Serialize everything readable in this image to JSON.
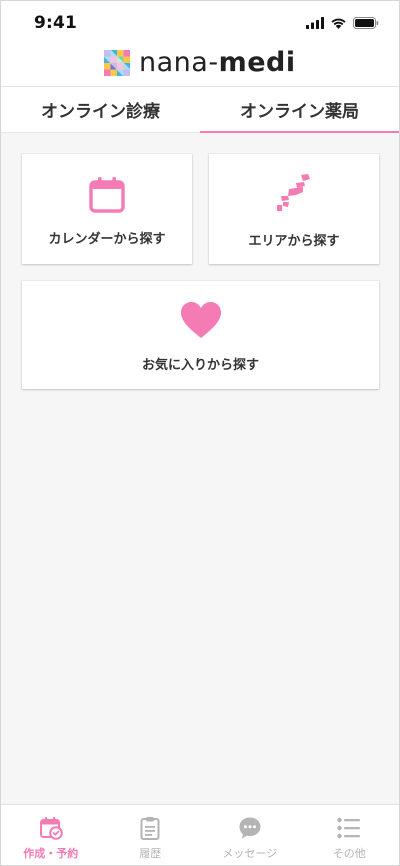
{
  "status": {
    "time": "9:41"
  },
  "header": {
    "logo_prefix": "nana-",
    "logo_suffix": "medi"
  },
  "tabs": [
    {
      "label": "オンライン診療",
      "active": false
    },
    {
      "label": "オンライン薬局",
      "active": true
    }
  ],
  "cards": {
    "calendar": {
      "label": "カレンダーから探す",
      "icon": "calendar-icon"
    },
    "area": {
      "label": "エリアから探す",
      "icon": "japan-map-icon"
    },
    "favorites": {
      "label": "お気に入りから探す",
      "icon": "heart-icon"
    }
  },
  "bottom_nav": [
    {
      "label": "作成・予約",
      "icon": "calendar-check-icon",
      "active": true
    },
    {
      "label": "履歴",
      "icon": "clipboard-icon",
      "active": false
    },
    {
      "label": "メッセージ",
      "icon": "chat-bubble-icon",
      "active": false
    },
    {
      "label": "その他",
      "icon": "list-icon",
      "active": false
    }
  ],
  "colors": {
    "accent": "#f47bb4",
    "inactive": "#b4b4b4",
    "background": "#f6f6f6"
  }
}
